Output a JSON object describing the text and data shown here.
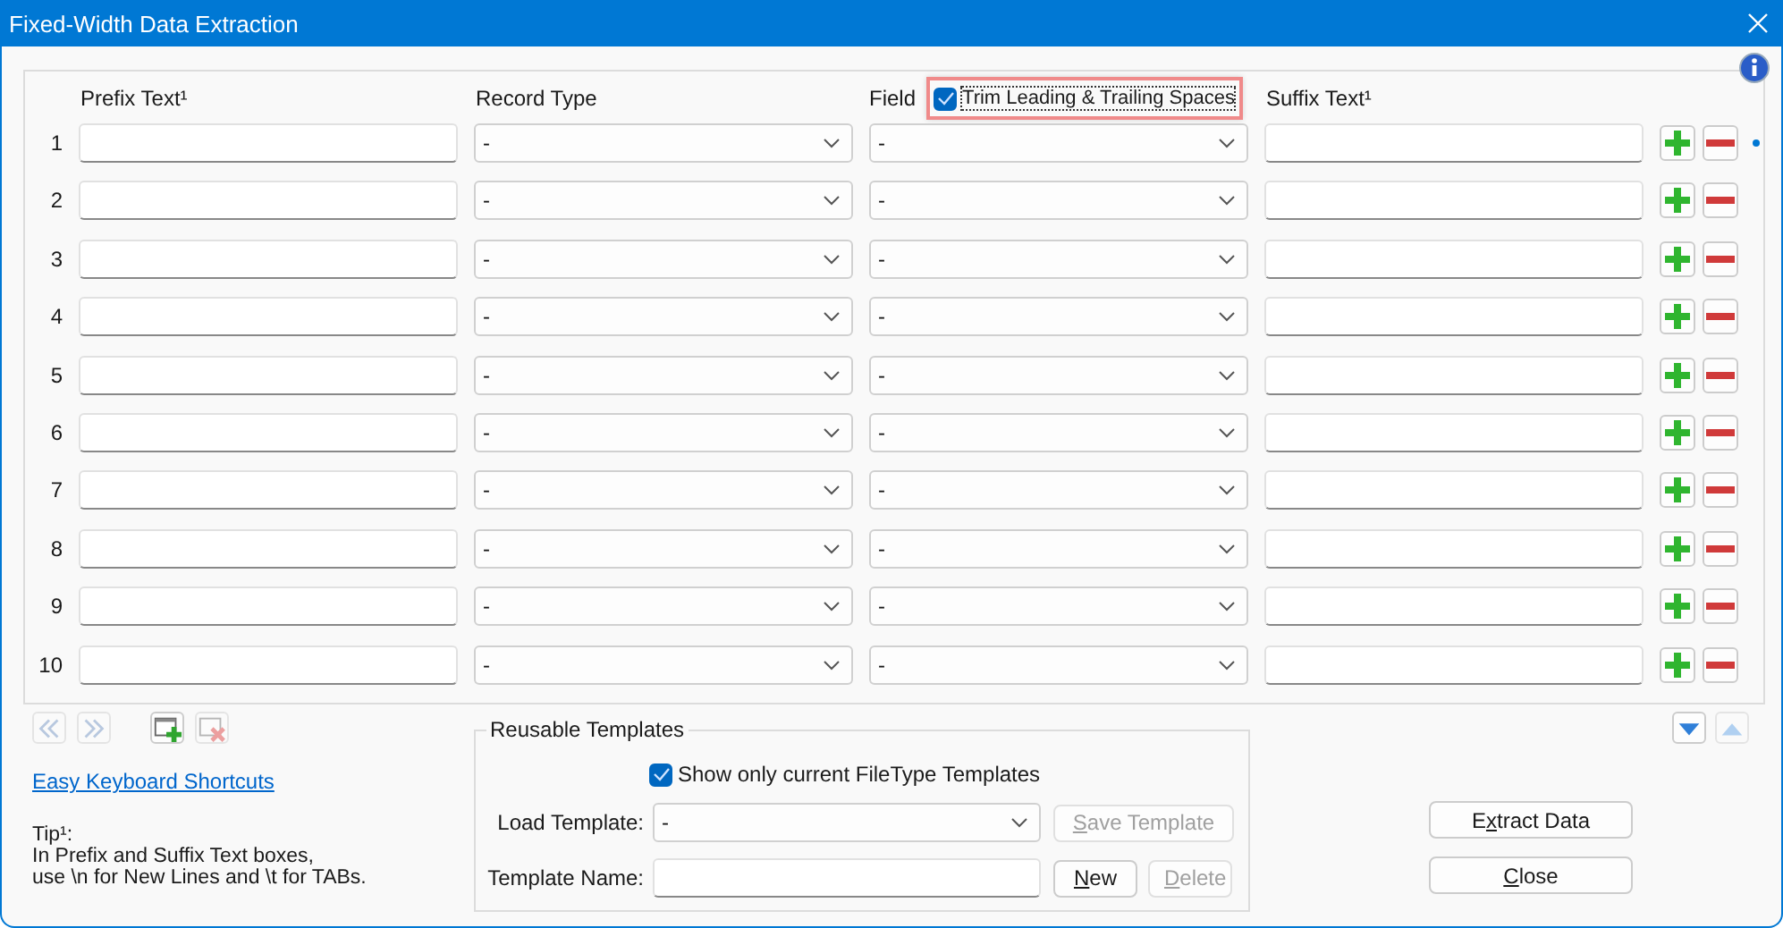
{
  "window": {
    "title": "Fixed-Width Data Extraction"
  },
  "columns": {
    "prefix": "Prefix Text¹",
    "record_type": "Record Type",
    "field": "Field",
    "suffix": "Suffix Text¹"
  },
  "trim_spaces": {
    "label": "Trim Leading & Trailing Spaces",
    "checked": true
  },
  "rows": [
    {
      "number": "1",
      "record_type": "-",
      "field": "-",
      "current": true
    },
    {
      "number": "2",
      "record_type": "-",
      "field": "-",
      "current": false
    },
    {
      "number": "3",
      "record_type": "-",
      "field": "-",
      "current": false
    },
    {
      "number": "4",
      "record_type": "-",
      "field": "-",
      "current": false
    },
    {
      "number": "5",
      "record_type": "-",
      "field": "-",
      "current": false
    },
    {
      "number": "6",
      "record_type": "-",
      "field": "-",
      "current": false
    },
    {
      "number": "7",
      "record_type": "-",
      "field": "-",
      "current": false
    },
    {
      "number": "8",
      "record_type": "-",
      "field": "-",
      "current": false
    },
    {
      "number": "9",
      "record_type": "-",
      "field": "-",
      "current": false
    },
    {
      "number": "10",
      "record_type": "-",
      "field": "-",
      "current": false
    }
  ],
  "nav_buttons": [
    {
      "kind": "first",
      "disabled": true
    },
    {
      "kind": "last",
      "disabled": true
    },
    {
      "kind": "add",
      "disabled": false
    },
    {
      "kind": "delete",
      "disabled": true
    }
  ],
  "shortcuts_link": "Easy Keyboard Shortcuts",
  "tip": [
    "Tip¹:",
    "In Prefix and Suffix Text boxes,",
    "use \\n for New Lines and \\t for TABs."
  ],
  "templates": {
    "title": "Reusable Templates",
    "filter": {
      "label": "Show only current FileType Templates",
      "checked": true
    },
    "load_label": "Load Template:",
    "load_value": "-",
    "save": {
      "label": "Save Template",
      "disabled": true
    },
    "name_label": "Template Name:",
    "new": {
      "label": "New",
      "disabled": false
    },
    "delete": {
      "label": "Delete",
      "disabled": true
    }
  },
  "move_buttons": [
    {
      "kind": "down",
      "disabled": false
    },
    {
      "kind": "up",
      "disabled": true
    }
  ],
  "actions": [
    {
      "label": "Extract Data"
    },
    {
      "label": "Close"
    }
  ]
}
